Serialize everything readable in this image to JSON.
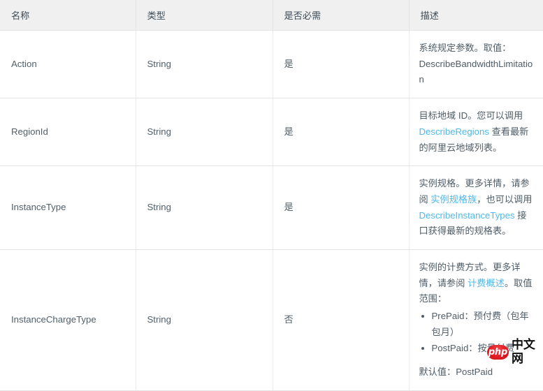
{
  "table": {
    "columns": [
      {
        "key": "name",
        "label": "名称"
      },
      {
        "key": "type",
        "label": "类型"
      },
      {
        "key": "required",
        "label": "是否必需"
      },
      {
        "key": "description",
        "label": "描述"
      }
    ],
    "rows": [
      {
        "name": "Action",
        "type": "String",
        "required": "是",
        "description": {
          "lead": "系统规定参数。取值：DescribeBandwidthLimitation",
          "parts": [
            {
              "text": "系统规定参数。取值：DescribeBandwidthLimitation",
              "link": false
            }
          ]
        }
      },
      {
        "name": "RegionId",
        "type": "String",
        "required": "是",
        "description": {
          "lead": "目标地域 ID。您可以调用 DescribeRegions 查看最新的阿里云地域列表。",
          "parts": [
            {
              "text": "目标地域 ID。您可以调用 ",
              "link": false
            },
            {
              "text": "DescribeRegions",
              "link": true
            },
            {
              "text": " 查看最新的阿里云地域列表。",
              "link": false
            }
          ]
        }
      },
      {
        "name": "InstanceType",
        "type": "String",
        "required": "是",
        "description": {
          "lead": "实例规格。更多详情，请参阅 实例规格族，也可以调用 DescribeInstanceTypes 接口获得最新的规格表。",
          "parts": [
            {
              "text": "实例规格。更多详情，请参阅 ",
              "link": false
            },
            {
              "text": "实例规格族",
              "link": true
            },
            {
              "text": "，也可以调用 ",
              "link": false
            },
            {
              "text": "DescribeInstanceTypes",
              "link": true
            },
            {
              "text": " 接口获得最新的规格表。",
              "link": false
            }
          ]
        }
      },
      {
        "name": "InstanceChargeType",
        "type": "String",
        "required": "否",
        "description": {
          "lead": "实例的计费方式。更多详情，请参阅 计费概述。取值范围：",
          "parts": [
            {
              "text": "实例的计费方式。更多详情，请参阅 ",
              "link": false
            },
            {
              "text": "计费概述",
              "link": true
            },
            {
              "text": "。取值范围：",
              "link": false
            }
          ],
          "bullets": [
            "PrePaid：预付费（包年包月）",
            "PostPaid：按量付费"
          ],
          "default_note": "默认值：PostPaid"
        }
      }
    ]
  },
  "watermark": {
    "badge_text": "php",
    "site_text": "中文网",
    "badge_color": "#e01b22"
  }
}
